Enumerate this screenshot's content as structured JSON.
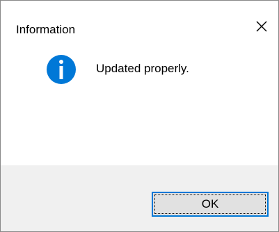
{
  "window": {
    "title": "Information",
    "close_icon": "close-icon"
  },
  "content": {
    "icon": "info-icon",
    "message": "Updated properly."
  },
  "footer": {
    "ok_label": "OK"
  },
  "colors": {
    "accent": "#0078d7",
    "footer_bg": "#f0f0f0",
    "button_bg": "#e1e1e1"
  }
}
